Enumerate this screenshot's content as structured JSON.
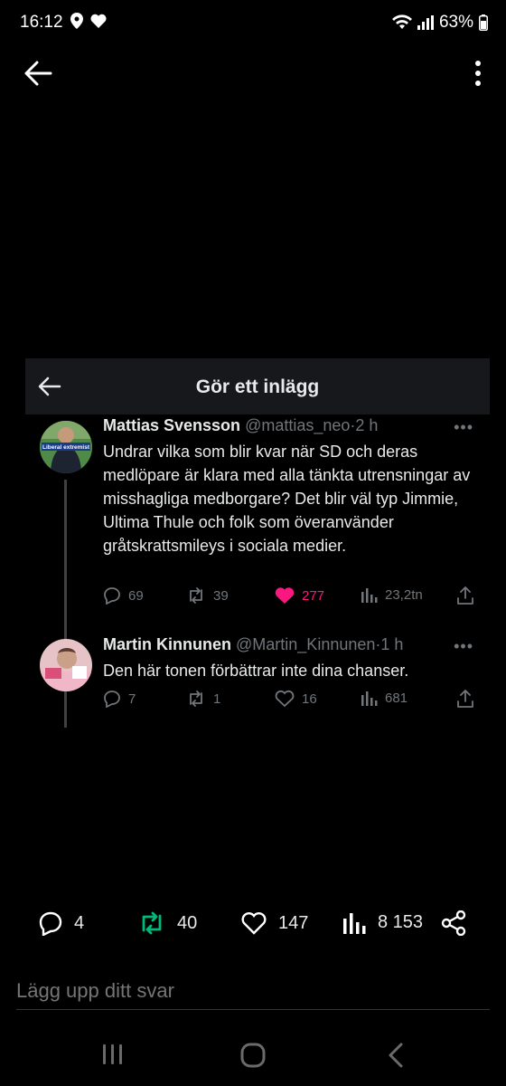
{
  "status_bar": {
    "time": "16:12",
    "battery": "63%",
    "icons_left": [
      "location-icon",
      "heart-icon"
    ],
    "icons_right": [
      "wifi-icon",
      "signal-icon",
      "battery-icon"
    ]
  },
  "embedded_screen": {
    "title": "Gör ett inlägg",
    "tweets": [
      {
        "name": "Mattias Svensson",
        "handle": "@mattias_neo",
        "dot": "·",
        "age": "2 h",
        "avatar_text": "Liberal extremist",
        "text": "Undrar vilka som blir kvar när SD och deras medlöpare är klara med alla tänkta utrensningar av misshagliga medborgare? Det blir väl typ Jimmie, Ultima Thule och folk som överanvänder gråtskrattsmileys i sociala medier.",
        "replies": "69",
        "retweets": "39",
        "likes": "277",
        "views": "23,2tn",
        "liked": true
      },
      {
        "name": "Martin Kinnunen",
        "handle": "@Martin_Kinnunen",
        "dot": "·",
        "age": "1 h",
        "text": "Den här tonen förbättrar inte dina chanser.",
        "replies": "7",
        "retweets": "1",
        "likes": "16",
        "views": "681",
        "liked": false
      }
    ]
  },
  "post_stats": {
    "replies": "4",
    "retweets": "40",
    "likes": "147",
    "views": "8 153"
  },
  "reply_box": {
    "placeholder": "Lägg upp ditt svar"
  },
  "colors": {
    "background": "#000000",
    "header_bg": "#16181c",
    "like_pink": "#f91880",
    "retweet_green": "#00ba7c",
    "muted": "#71767b"
  }
}
